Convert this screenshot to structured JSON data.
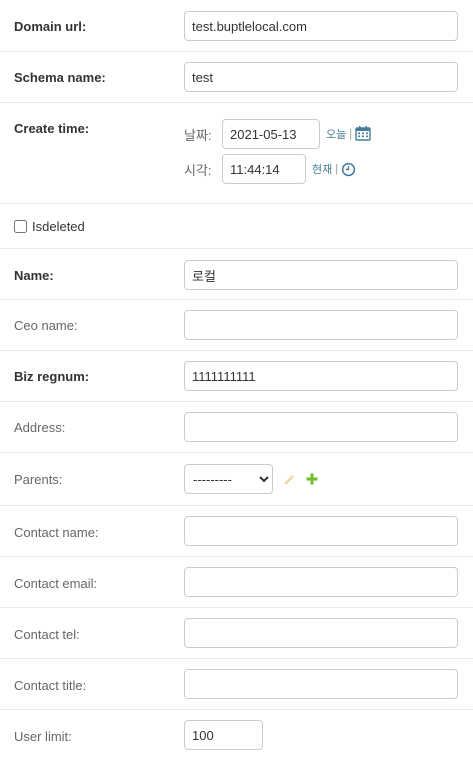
{
  "fields": {
    "domain_url": {
      "label": "Domain url:",
      "value": "test.buptlelocal.com"
    },
    "schema_name": {
      "label": "Schema name:",
      "value": "test"
    },
    "create_time": {
      "label": "Create time:",
      "date_label": "날짜:",
      "date_value": "2021-05-13",
      "today_link": "오늘",
      "separator": "|",
      "time_label": "시각:",
      "time_value": "11:44:14",
      "now_link": "현재"
    },
    "isdeleted": {
      "label": "Isdeleted",
      "checked": false
    },
    "name": {
      "label": "Name:",
      "value": "로컬"
    },
    "ceo_name": {
      "label": "Ceo name:",
      "value": ""
    },
    "biz_regnum": {
      "label": "Biz regnum:",
      "value": "1111111111"
    },
    "address": {
      "label": "Address:",
      "value": ""
    },
    "parents": {
      "label": "Parents:",
      "selected": "---------"
    },
    "contact_name": {
      "label": "Contact name:",
      "value": ""
    },
    "contact_email": {
      "label": "Contact email:",
      "value": ""
    },
    "contact_tel": {
      "label": "Contact tel:",
      "value": ""
    },
    "contact_title": {
      "label": "Contact title:",
      "value": ""
    },
    "user_limit": {
      "label": "User limit:",
      "value": "100"
    }
  },
  "icons": {
    "calendar": "calendar-icon",
    "clock": "clock-icon",
    "edit": "pencil-icon",
    "add": "plus-icon"
  },
  "colors": {
    "link": "#447e9b",
    "add_green": "#70bf2b",
    "edit_disabled": "#efd9a5",
    "border": "#cccccc"
  }
}
